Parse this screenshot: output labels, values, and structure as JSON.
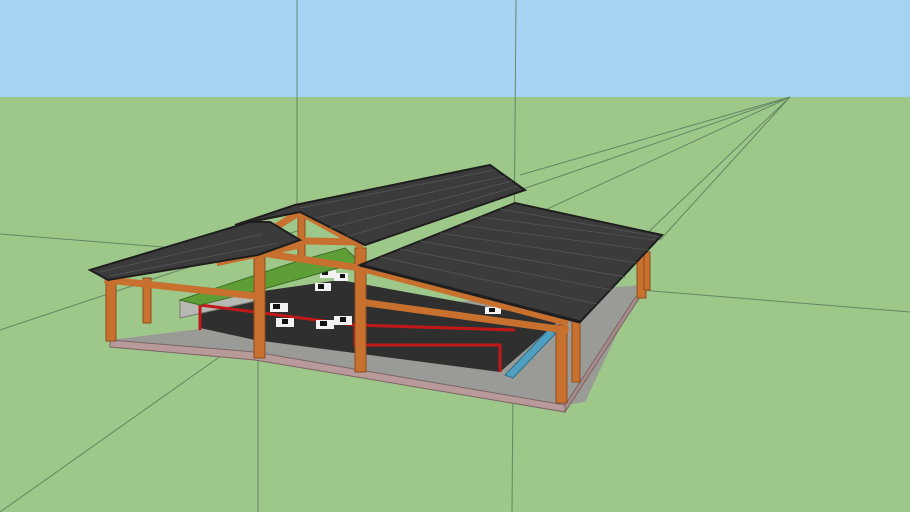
{
  "app": {
    "type": "3d-modeling-viewport"
  },
  "colors": {
    "sky": "#a6d2f4",
    "ground": "#9ec78a",
    "axis_lines": "#5a7a5a",
    "roof": "#3b3b3b",
    "roof_edge": "#1e1e1e",
    "timber": "#c8712f",
    "timber_dark": "#8e4d1d",
    "floor": "#2f2f2f",
    "foundation": "#b89a9a",
    "feed_rail": "#c01818",
    "green_roof": "#5d9e36",
    "water_trough": "#4f9fc0",
    "cow_white": "#f2f2f2",
    "cow_black": "#111111"
  },
  "scene": {
    "model_name": "",
    "objects": [
      {
        "name": "barn-roof-left",
        "material": "roof-tiles"
      },
      {
        "name": "barn-roof-right",
        "material": "roof-tiles"
      },
      {
        "name": "green-roof-strip",
        "material": "grass"
      },
      {
        "name": "timber-frame",
        "material": "wood"
      },
      {
        "name": "concrete-floor",
        "material": "concrete"
      },
      {
        "name": "feed-rail",
        "material": "red-metal"
      },
      {
        "name": "water-trough",
        "material": "water"
      },
      {
        "name": "cattle",
        "count": 8
      }
    ]
  }
}
